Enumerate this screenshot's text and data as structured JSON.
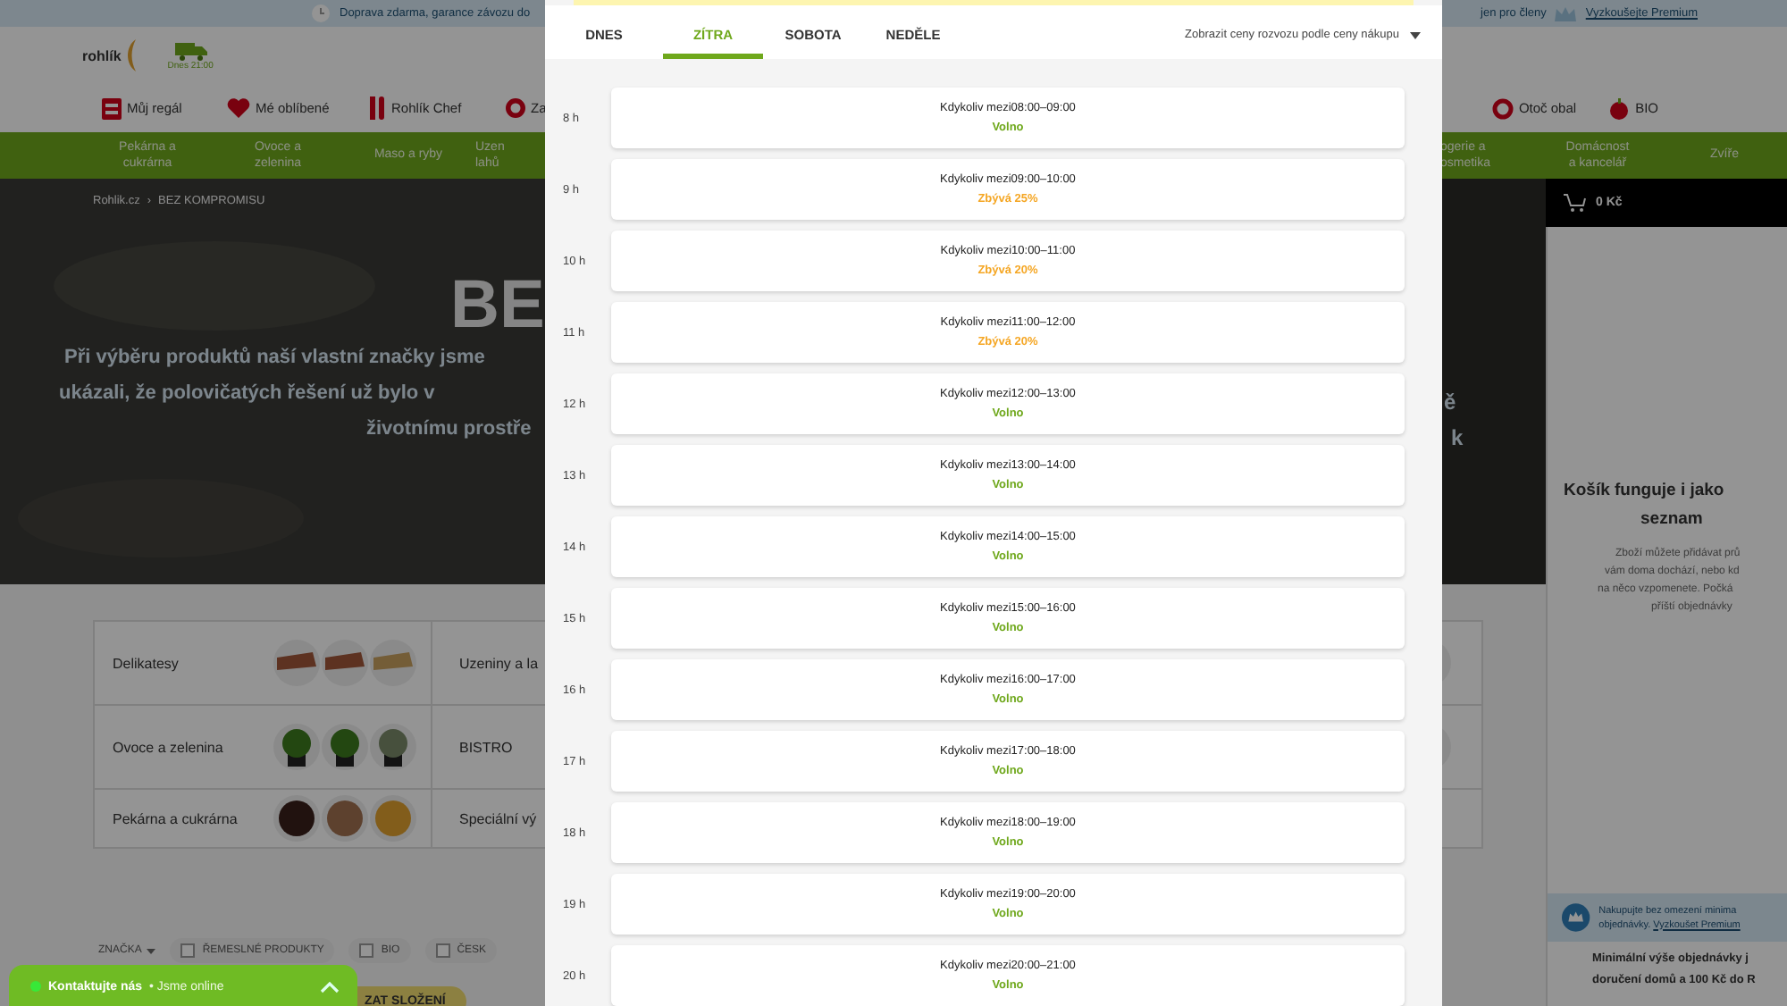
{
  "top_bar": {
    "left_text": "Doprava zdarma, garance závozu do",
    "right_text": "jen pro členy",
    "premium_link": "Vyzkoušejte Premium"
  },
  "header": {
    "logo": "rohlík",
    "delivery": "Dnes 21:00"
  },
  "nav_left": [
    "Můj regál",
    "Mé oblíbené",
    "Rohlík Chef",
    "Za"
  ],
  "nav_right": [
    "Otoč obal",
    "BIO"
  ],
  "categories_left": [
    [
      "Pekárna a",
      "cukrárna"
    ],
    [
      "Ovoce a",
      "zelenina"
    ],
    [
      "Maso a ryby"
    ],
    [
      "Uzen",
      "lahů"
    ]
  ],
  "categories_right": [
    [
      "ogerie a",
      "osmetika"
    ],
    [
      "Domácnost",
      "a kancelář"
    ],
    [
      "Zvíře"
    ]
  ],
  "breadcrumb": {
    "home": "Rohlik.cz",
    "separator": "›",
    "current": "BEZ KOMPROMISU"
  },
  "hero": {
    "title": "BE",
    "lines": [
      "Při výběru produktů naší vlastní značky jsme",
      "ukázali, že polovičatých řešení už bylo v",
      "životnímu prostře"
    ],
    "right_lines": [
      "ě",
      "k"
    ]
  },
  "category_table": [
    {
      "left": "Delikatesy",
      "right": "Uzeniny a la"
    },
    {
      "left": "Ovoce a zelenina",
      "right": "BISTRO"
    },
    {
      "left": "Pekárna a cukrárna",
      "right": "Speciální vý"
    }
  ],
  "filters": [
    {
      "label": "ZNAČKA",
      "kind": "dropdown"
    },
    {
      "label": "ŘEMESLNÉ PRODUKTY",
      "kind": "checkbox"
    },
    {
      "label": "BIO",
      "kind": "checkbox"
    },
    {
      "label": "ČESK",
      "kind": "checkbox"
    }
  ],
  "composition_button": "ZAT SLOŽENÍ",
  "cart": {
    "total": "0 Kč",
    "heading": [
      "Košík funguje i jako",
      "seznam"
    ],
    "text": [
      "Zboží můžete přidávat prů",
      "vám doma dochází, nebo kd",
      "na něco vzpomenete. Počká",
      "příští objednávky"
    ],
    "premium_text": "Nakupujte bez omezení minima objednávky.",
    "premium_link": "Vyzkoušet Premium",
    "minimum": [
      "Minimální výše objednávky j",
      "doručení domů a 100 Kč do R"
    ]
  },
  "chat": {
    "title": "Kontaktujte nás",
    "status": "• Jsme online"
  },
  "modal": {
    "tabs": [
      {
        "label": "DNES",
        "selected": false
      },
      {
        "label": "ZÍTRA",
        "selected": true
      },
      {
        "label": "SOBOTA",
        "selected": false
      },
      {
        "label": "NEDĚLE",
        "selected": false
      }
    ],
    "price_dropdown": "Zobrazit ceny rozvozu podle ceny nákupu",
    "slots": [
      {
        "hour": "8 h",
        "time": "Kdykoliv mezi08:00–09:00",
        "status": "Volno",
        "kind": "free"
      },
      {
        "hour": "9 h",
        "time": "Kdykoliv mezi09:00–10:00",
        "status": "Zbývá 25%",
        "kind": "limited"
      },
      {
        "hour": "10 h",
        "time": "Kdykoliv mezi10:00–11:00",
        "status": "Zbývá 20%",
        "kind": "limited"
      },
      {
        "hour": "11 h",
        "time": "Kdykoliv mezi11:00–12:00",
        "status": "Zbývá 20%",
        "kind": "limited"
      },
      {
        "hour": "12 h",
        "time": "Kdykoliv mezi12:00–13:00",
        "status": "Volno",
        "kind": "free"
      },
      {
        "hour": "13 h",
        "time": "Kdykoliv mezi13:00–14:00",
        "status": "Volno",
        "kind": "free"
      },
      {
        "hour": "14 h",
        "time": "Kdykoliv mezi14:00–15:00",
        "status": "Volno",
        "kind": "free"
      },
      {
        "hour": "15 h",
        "time": "Kdykoliv mezi15:00–16:00",
        "status": "Volno",
        "kind": "free"
      },
      {
        "hour": "16 h",
        "time": "Kdykoliv mezi16:00–17:00",
        "status": "Volno",
        "kind": "free"
      },
      {
        "hour": "17 h",
        "time": "Kdykoliv mezi17:00–18:00",
        "status": "Volno",
        "kind": "free"
      },
      {
        "hour": "18 h",
        "time": "Kdykoliv mezi18:00–19:00",
        "status": "Volno",
        "kind": "free"
      },
      {
        "hour": "19 h",
        "time": "Kdykoliv mezi19:00–20:00",
        "status": "Volno",
        "kind": "free"
      },
      {
        "hour": "20 h",
        "time": "Kdykoliv mezi20:00–21:00",
        "status": "Volno",
        "kind": "free"
      }
    ]
  }
}
